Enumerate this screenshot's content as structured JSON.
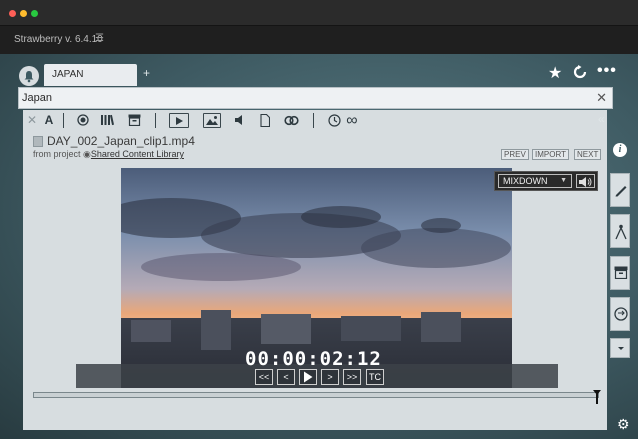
{
  "window": {
    "title": "Strawberry v. 6.4.10",
    "menu_icon": "hamburger-icon"
  },
  "tabs": [
    {
      "label": "JAPAN"
    }
  ],
  "tab_add_label": "+",
  "search": {
    "value": "Japan",
    "clear_icon": "close-icon"
  },
  "header_icons": [
    "star-icon",
    "refresh-icon",
    "more-icon"
  ],
  "toolbar": {
    "icons": [
      "close-icon",
      "text-icon",
      "record-icon",
      "library-icon",
      "archive-icon",
      "video-icon",
      "image-icon",
      "audio-icon",
      "document-icon",
      "link-icon",
      "clock-icon",
      "loop-icon"
    ],
    "collapse_label": "«"
  },
  "asset": {
    "filename": "DAY_002_Japan_clip1.mp4",
    "from_text": "from project",
    "project_link": "Shared Content Library",
    "prev_label": "PREV",
    "import_label": "IMPORT",
    "next_label": "NEXT"
  },
  "audio": {
    "mix_value": "MIXDOWN",
    "speaker_icon": "speaker-icon"
  },
  "player": {
    "timecode": "00:00:02:12",
    "buttons": [
      "<<",
      "<",
      ">",
      ">",
      ">>",
      "TC"
    ],
    "progress": 0.99
  },
  "side_tools": [
    "info-icon",
    "pen-icon",
    "compass-icon",
    "archive-icon",
    "transfer-icon",
    "chevron-down-icon"
  ],
  "settings_icon": "gear-icon",
  "colors": {
    "accent": "#3e5a62",
    "panel": "#d7dde0"
  }
}
